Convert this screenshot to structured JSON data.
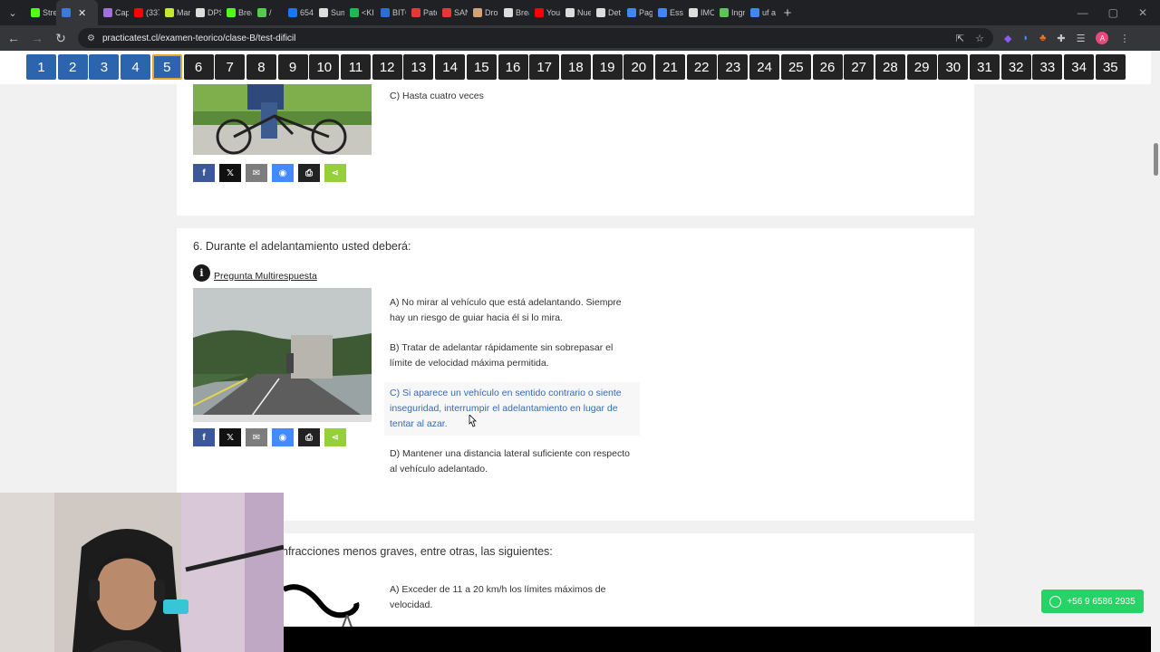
{
  "browser": {
    "tabs": [
      {
        "label": "Stre",
        "color": "#53fc18"
      },
      {
        "label": "",
        "color": "#3a7bd5",
        "active": true
      },
      {
        "label": "Capt",
        "color": "#a070e0"
      },
      {
        "label": "(337",
        "color": "#ff0000"
      },
      {
        "label": "Mar",
        "color": "#c5e830"
      },
      {
        "label": "DPS",
        "color": "#dddddd"
      },
      {
        "label": "Brea",
        "color": "#53fc18"
      },
      {
        "label": "/",
        "color": "#59c851"
      },
      {
        "label": "654",
        "color": "#1877f2"
      },
      {
        "label": "Sum",
        "color": "#dddddd"
      },
      {
        "label": "<KI",
        "color": "#1db954"
      },
      {
        "label": "BITC",
        "color": "#2b6fd6"
      },
      {
        "label": "Pato",
        "color": "#e53935"
      },
      {
        "label": "SAN",
        "color": "#e53935"
      },
      {
        "label": "Drop",
        "color": "#d4a373"
      },
      {
        "label": "Brea",
        "color": "#dddddd"
      },
      {
        "label": "You",
        "color": "#ff0000"
      },
      {
        "label": "Nue",
        "color": "#dddddd"
      },
      {
        "label": "Det",
        "color": "#dddddd"
      },
      {
        "label": "Pag",
        "color": "#4285f4"
      },
      {
        "label": "Essl",
        "color": "#4285f4"
      },
      {
        "label": "IMC",
        "color": "#dddddd"
      },
      {
        "label": "Ingr",
        "color": "#59c851"
      },
      {
        "label": "uf a",
        "color": "#4285f4"
      }
    ],
    "url": "practicatest.cl/examen-teorico/clase-B/test-dificil"
  },
  "question_nav": {
    "numbers": [
      "1",
      "2",
      "3",
      "4",
      "5",
      "6",
      "7",
      "8",
      "9",
      "10",
      "11",
      "12",
      "13",
      "14",
      "15",
      "16",
      "17",
      "18",
      "19",
      "20",
      "21",
      "22",
      "23",
      "24",
      "25",
      "26",
      "27",
      "28",
      "29",
      "30",
      "31",
      "32",
      "33",
      "34",
      "35"
    ],
    "done_count": 4,
    "current": 5
  },
  "q5": {
    "option_c": "C) Hasta cuatro veces"
  },
  "q6": {
    "title": "6. Durante el adelantamiento usted deberá:",
    "info_label": "Pregunta Multirespuesta",
    "option_a": "A) No mirar al vehículo que está adelantando. Siempre hay un riesgo de guiar hacia él si lo mira.",
    "option_b": "B) Tratar de adelantar rápidamente sin sobrepasar el límite de velocidad máxima permitida.",
    "option_c": "C) Si aparece un vehículo en sentido contrario o siente inseguridad, interrumpir el adelantamiento en lugar de tentar al azar.",
    "option_d": "D) Mantener una distancia lateral suficiente con respecto al vehículo adelantado."
  },
  "q7": {
    "title_partial": "nfracciones menos graves, entre otras, las siguientes:",
    "option_a": "A) Exceder de 11 a 20 km/h los límites máximos de velocidad."
  },
  "share_buttons": [
    {
      "name": "facebook",
      "glyph": "f",
      "color": "#3b5998"
    },
    {
      "name": "twitter",
      "glyph": "𝕏",
      "color": "#111111"
    },
    {
      "name": "email",
      "glyph": "✉",
      "color": "#7d7d7d"
    },
    {
      "name": "messenger",
      "glyph": "◉",
      "color": "#448aff"
    },
    {
      "name": "print",
      "glyph": "⎙",
      "color": "#222222"
    },
    {
      "name": "share",
      "glyph": "⋖",
      "color": "#95d03a"
    }
  ],
  "whatsapp": {
    "number": "+56 9 6586 2935",
    "color": "#25d366"
  }
}
